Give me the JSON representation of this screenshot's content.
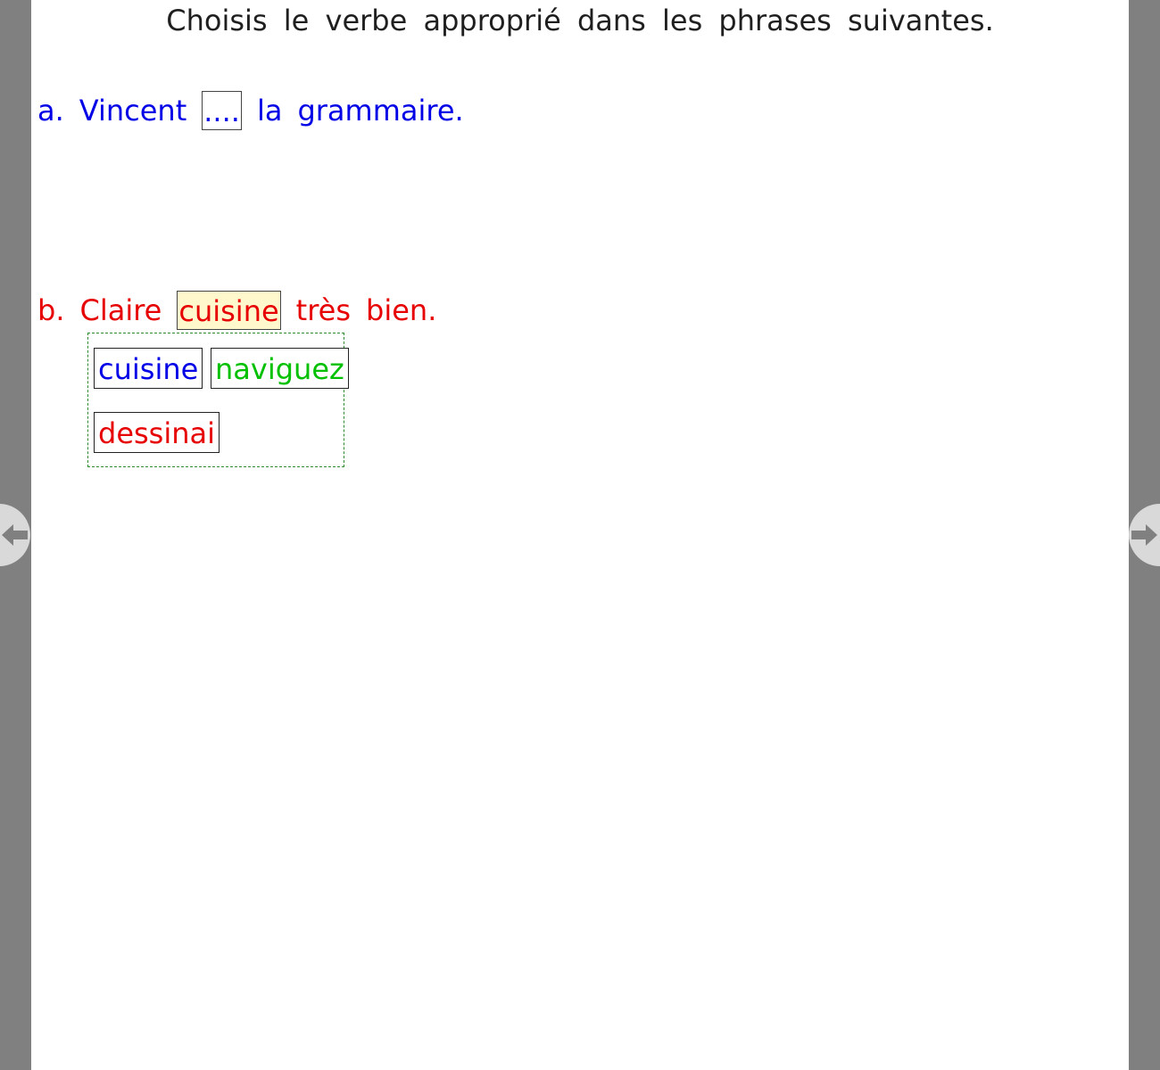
{
  "instruction": "Choisis le verbe approprié dans les phrases suivantes.",
  "colors": {
    "sentence_a": "#0000e6",
    "sentence_b": "#e60000",
    "choice_blue": "#0000e6",
    "choice_green": "#00c000",
    "choice_red": "#e60000",
    "highlight": "#fff8cc"
  },
  "sentences": [
    {
      "letter": "a.",
      "before": [
        "Vincent"
      ],
      "blank": "....",
      "after": [
        "la",
        "grammaire."
      ]
    },
    {
      "letter": "b.",
      "before": [
        "Claire"
      ],
      "blank": "cuisine",
      "after": [
        "très",
        "bien."
      ]
    }
  ],
  "choices": [
    {
      "label": "cuisine",
      "color": "#0000e6"
    },
    {
      "label": "naviguez",
      "color": "#00c000"
    },
    {
      "label": "dessinai",
      "color": "#e60000"
    }
  ],
  "nav": {
    "prev_icon": "arrow-left-icon",
    "next_icon": "arrow-right-icon"
  }
}
